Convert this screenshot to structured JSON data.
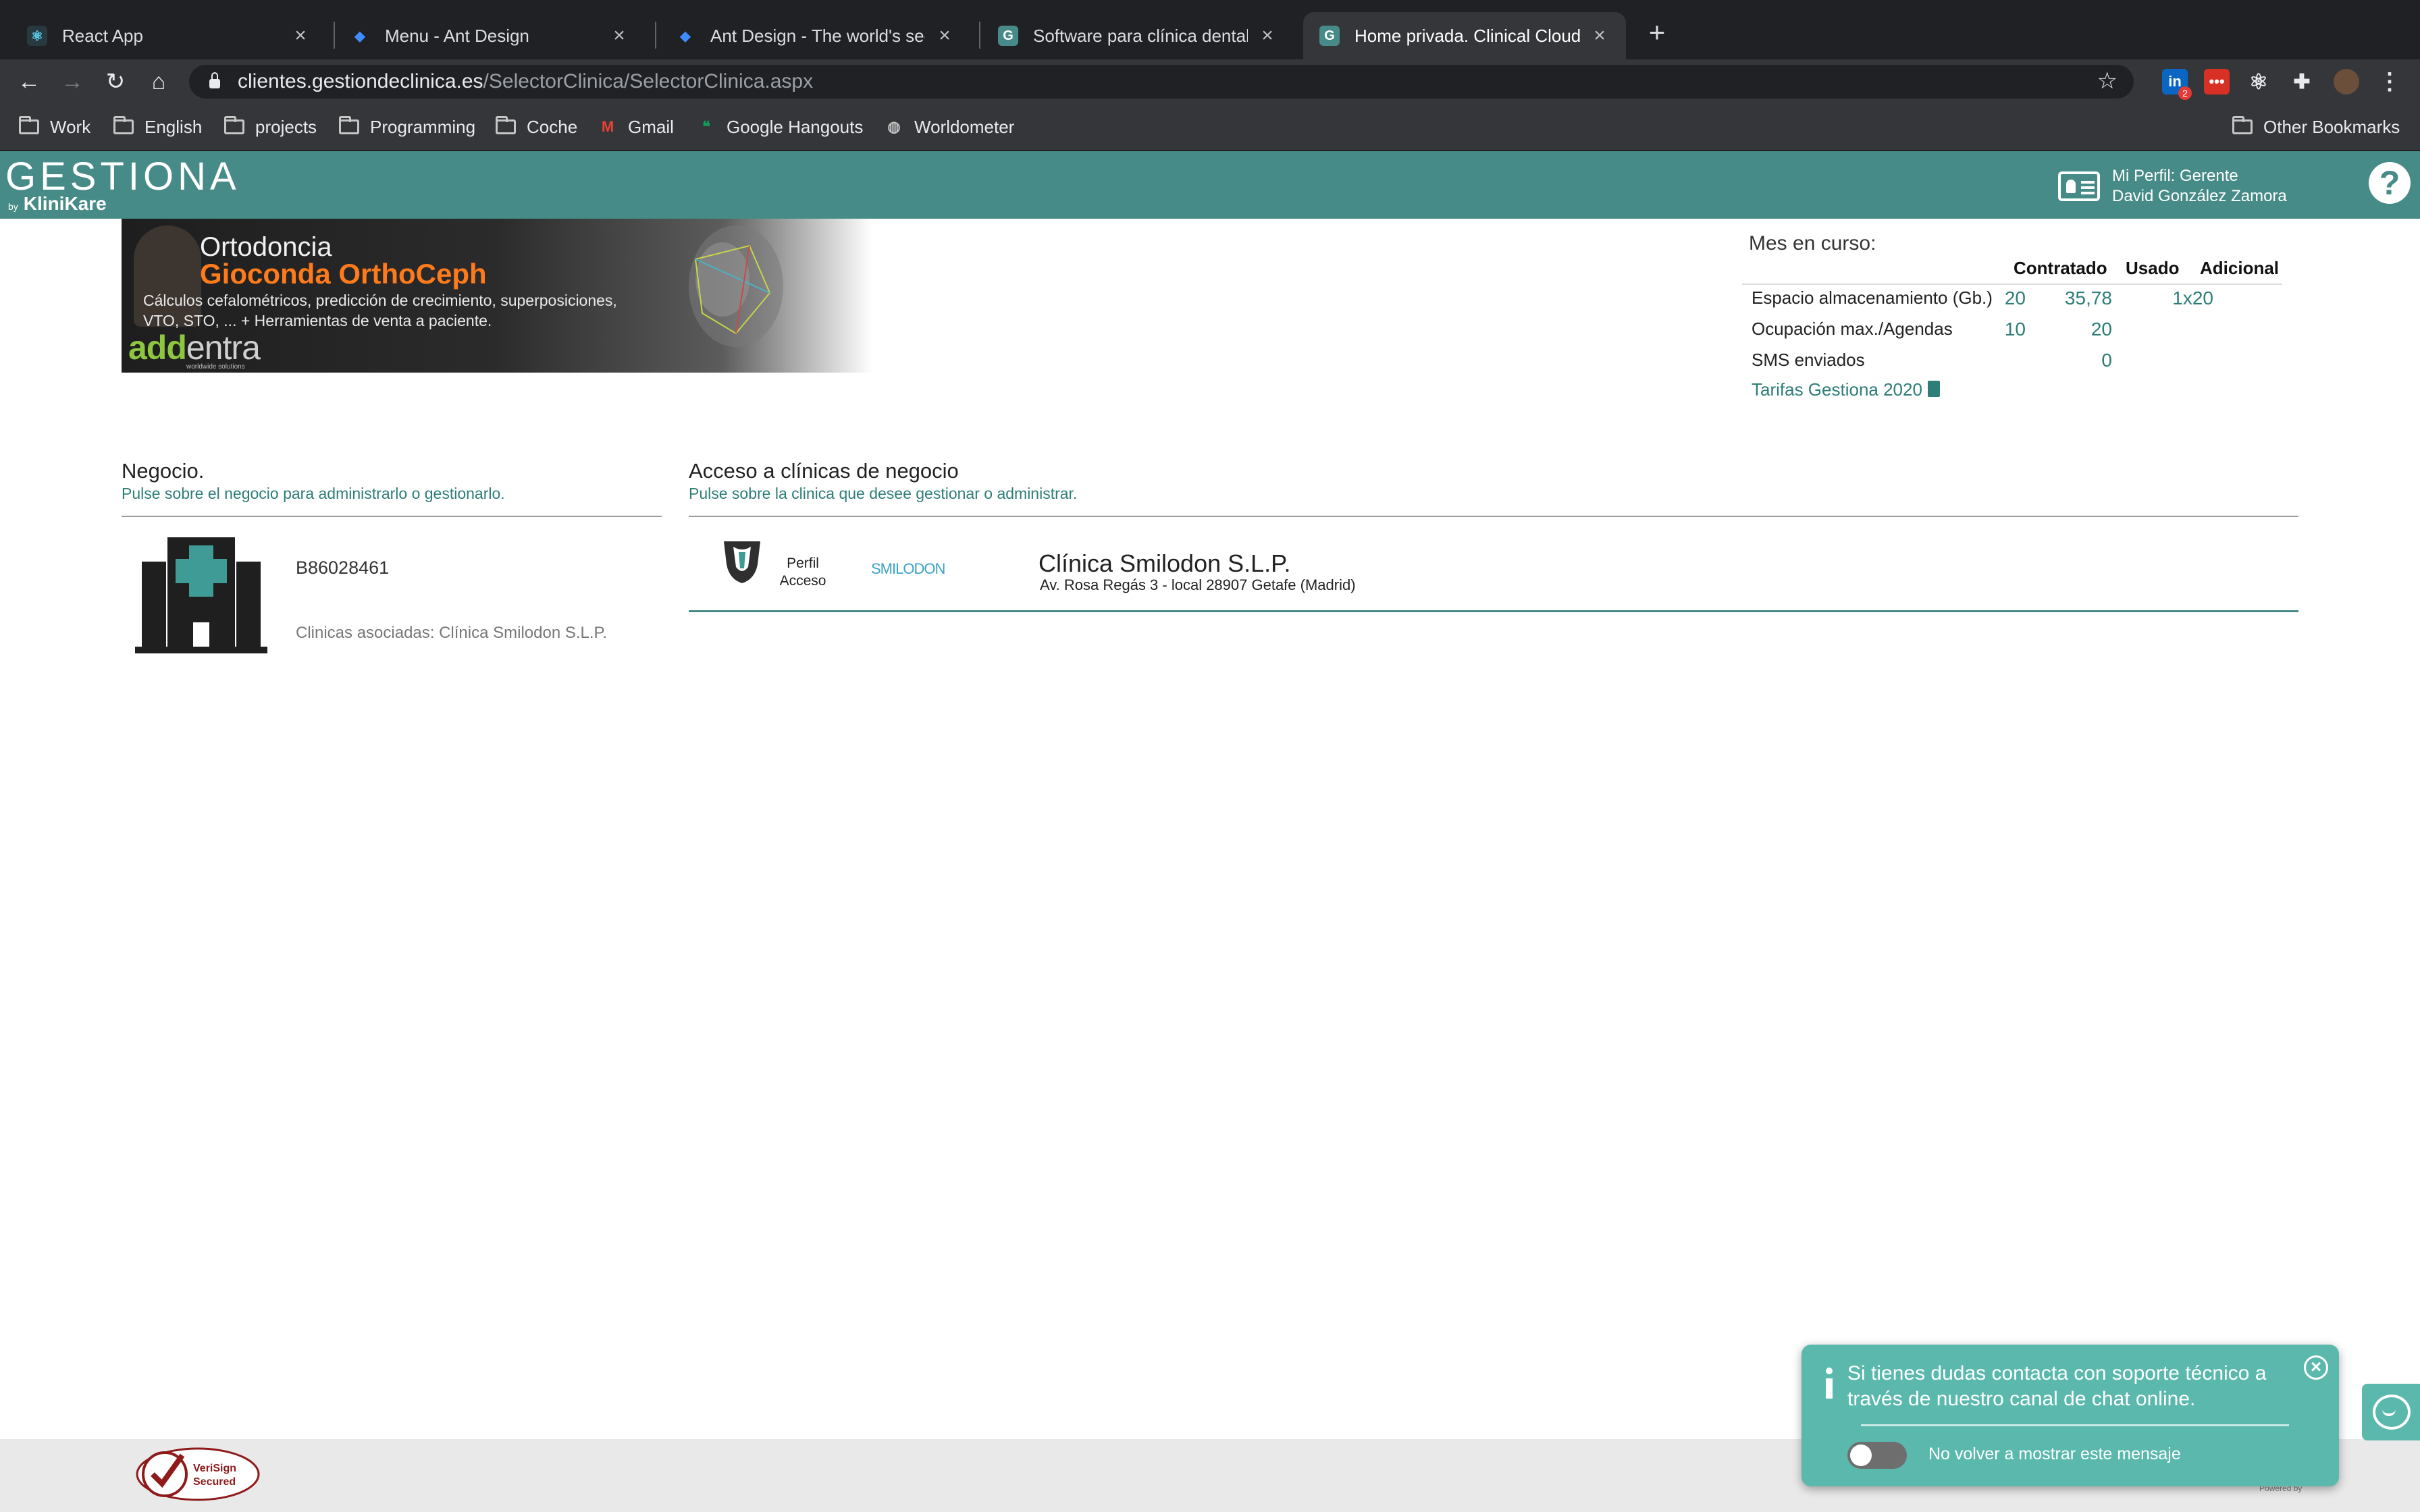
{
  "browser": {
    "tabs": [
      {
        "title": "React App",
        "icon": "react-icon"
      },
      {
        "title": "Menu - Ant Design",
        "icon": "ant-design-icon"
      },
      {
        "title": "Ant Design - The world's secon",
        "icon": "ant-design-icon"
      },
      {
        "title": "Software para clínica dental en",
        "icon": "gestiona-icon"
      },
      {
        "title": "Home privada. Clinical Cloud.",
        "icon": "gestiona-icon",
        "active": true
      }
    ],
    "url_host": "clientes.gestiondeclinica.es",
    "url_path": "/SelectorClinica/SelectorClinica.aspx",
    "extension_badge": "2",
    "bookmarks": [
      {
        "label": "Work",
        "icon": "folder-icon"
      },
      {
        "label": "English",
        "icon": "folder-icon"
      },
      {
        "label": "projects",
        "icon": "folder-icon"
      },
      {
        "label": "Programming",
        "icon": "folder-icon"
      },
      {
        "label": "Coche",
        "icon": "folder-icon"
      },
      {
        "label": "Gmail",
        "icon": "gmail-icon"
      },
      {
        "label": "Google Hangouts",
        "icon": "hangouts-icon"
      },
      {
        "label": "Worldometer",
        "icon": "globe-icon"
      }
    ],
    "other_bookmarks": "Other Bookmarks"
  },
  "app": {
    "logo": "GESTIONA",
    "logo_by": "by",
    "logo_brand": "KliniKare",
    "profile_line1": "Mi Perfil: Gerente",
    "profile_line2": "David González Zamora",
    "accent_color": "#468b87"
  },
  "banner": {
    "title": "Ortodoncia",
    "product": "Gioconda OrthoCeph",
    "desc_line1": "Cálculos cefalométricos, predicción de crecimiento, superposiciones,",
    "desc_line2": "VTO, STO, ... + Herramientas de venta a paciente.",
    "brand_main": "add",
    "brand_rest": "entra",
    "brand_tagline": "worldwide solutions"
  },
  "usage": {
    "title": "Mes en curso:",
    "headers": [
      "Contratado",
      "Usado",
      "Adicional"
    ],
    "rows": [
      {
        "label": "Espacio almacenamiento (Gb.)",
        "contratado": "20",
        "usado": "35,78",
        "adicional": "1x20"
      },
      {
        "label": "Ocupación max./Agendas",
        "contratado": "10",
        "usado": "20",
        "adicional": ""
      },
      {
        "label": "SMS enviados",
        "contratado": "",
        "usado": "0",
        "adicional": ""
      }
    ],
    "tarifas_link": "Tarifas Gestiona 2020"
  },
  "negocio": {
    "title": "Negocio.",
    "subtitle": "Pulse sobre el negocio para administrarlo o gestionarlo.",
    "id": "B86028461",
    "associated": "Clinicas asociadas: Clínica Smilodon S.L.P."
  },
  "clinicas": {
    "title": "Acceso a clínicas de negocio",
    "subtitle": "Pulse sobre la clinica que desee gestionar o administrar.",
    "items": [
      {
        "perfil_line1": "Perfil",
        "perfil_line2": "Acceso",
        "logo_text": "SMILODON",
        "name": "Clínica Smilodon S.L.P.",
        "address": "Av. Rosa Regás 3 - local 28907 Getafe (Madrid)"
      }
    ]
  },
  "chat": {
    "message": "Si tienes dudas contacta con soporte técnico a través de nuestro canal de chat online.",
    "toggle_label": "No volver a mostrar este mensaje",
    "close_symbol": "×"
  },
  "footer": {
    "verisign_line1": "VeriSign",
    "verisign_line2": "Secured",
    "powered_by": "Powered by"
  }
}
